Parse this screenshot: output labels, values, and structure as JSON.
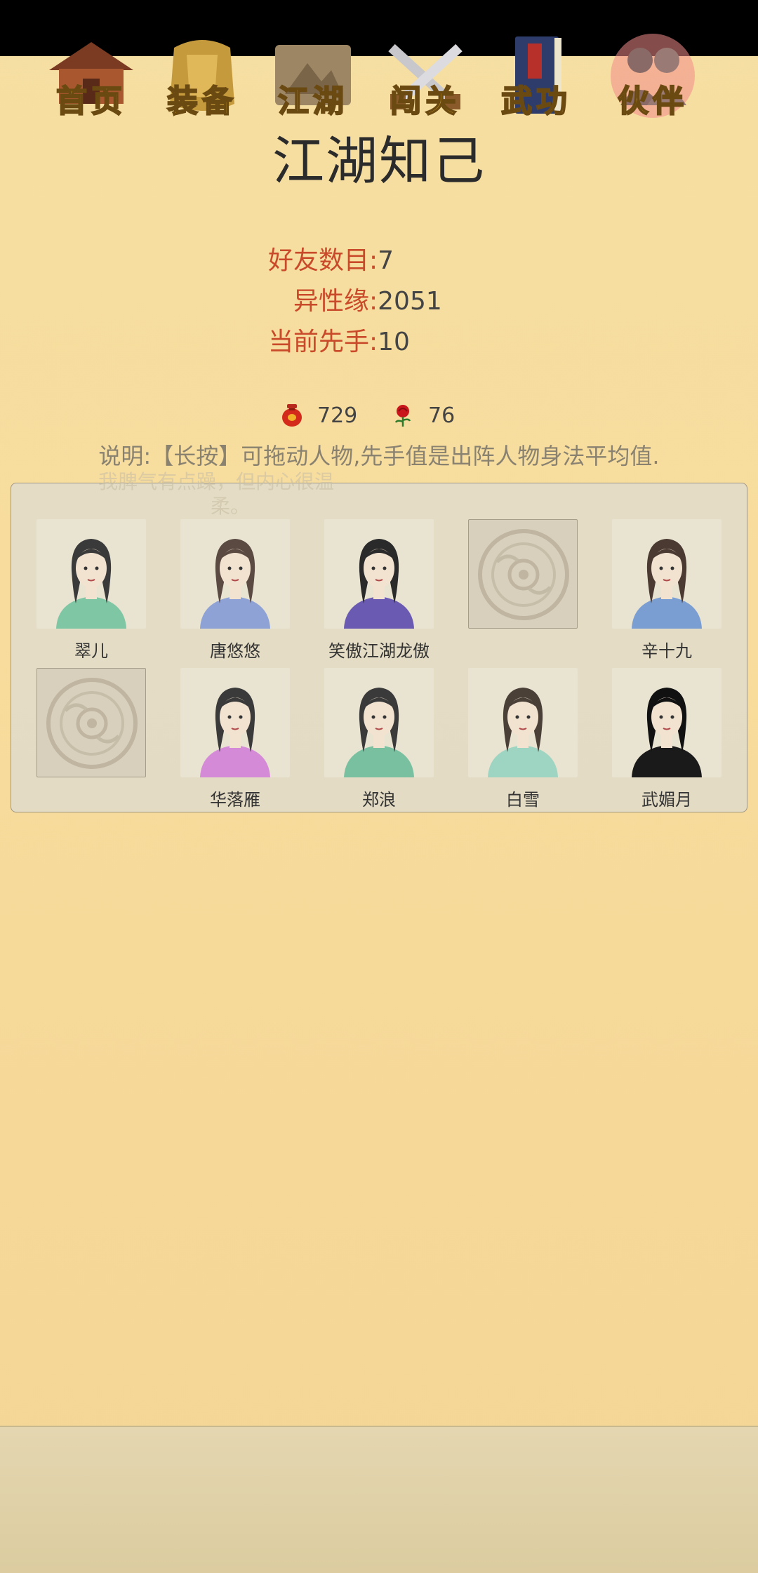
{
  "page": {
    "title": "江湖知己"
  },
  "stats": [
    {
      "label": "好友数目:",
      "value": "7"
    },
    {
      "label": "异性缘:",
      "value": "2051"
    },
    {
      "label": "当前先手:",
      "value": "10"
    }
  ],
  "resources": [
    {
      "icon": "wine-jar-icon",
      "value": "729"
    },
    {
      "icon": "rose-icon",
      "value": "76"
    }
  ],
  "note": "说明:【长按】可拖动人物,先手值是出阵人物身法平均值.",
  "ghost_text": {
    "line1": "我脾气有点躁，但内心很温",
    "line2": "柔。"
  },
  "companions": [
    {
      "name": "翠儿",
      "hair": "#3a3a3a",
      "cloth": "#7fc6a4",
      "skin": "#f2e2d0",
      "empty": false
    },
    {
      "name": "唐悠悠",
      "hair": "#5a4a42",
      "cloth": "#8ea2d6",
      "skin": "#f2e2d0",
      "empty": false
    },
    {
      "name": "笑傲江湖龙傲",
      "hair": "#2a2a2a",
      "cloth": "#6a5ab2",
      "skin": "#f2e2d0",
      "empty": false
    },
    {
      "name": "",
      "hair": "",
      "cloth": "",
      "skin": "",
      "empty": true
    },
    {
      "name": "辛十九",
      "hair": "#4a3a32",
      "cloth": "#7b9ed2",
      "skin": "#f2e2d0",
      "empty": false
    },
    {
      "name": "",
      "hair": "",
      "cloth": "",
      "skin": "",
      "empty": true
    },
    {
      "name": "华落雁",
      "hair": "#3a3a3a",
      "cloth": "#d58ad8",
      "skin": "#f2e2d0",
      "empty": false
    },
    {
      "name": "郑浪",
      "hair": "#3a3a3a",
      "cloth": "#78c0a0",
      "skin": "#f2e2d0",
      "empty": false
    },
    {
      "name": "白雪",
      "hair": "#4a4038",
      "cloth": "#9ed4c2",
      "skin": "#f2e2d0",
      "empty": false
    },
    {
      "name": "武媚月",
      "hair": "#111111",
      "cloth": "#1a1a1a",
      "skin": "#f2e2d0",
      "empty": false
    }
  ],
  "nav": [
    {
      "label": "首页",
      "icon": "house-icon",
      "active": false
    },
    {
      "label": "装备",
      "icon": "armor-icon",
      "active": false
    },
    {
      "label": "江湖",
      "icon": "scroll-map-icon",
      "active": false
    },
    {
      "label": "闯关",
      "icon": "swords-icon",
      "active": false
    },
    {
      "label": "武功",
      "icon": "book-icon",
      "active": false
    },
    {
      "label": "伙伴",
      "icon": "partners-icon",
      "active": true
    }
  ]
}
